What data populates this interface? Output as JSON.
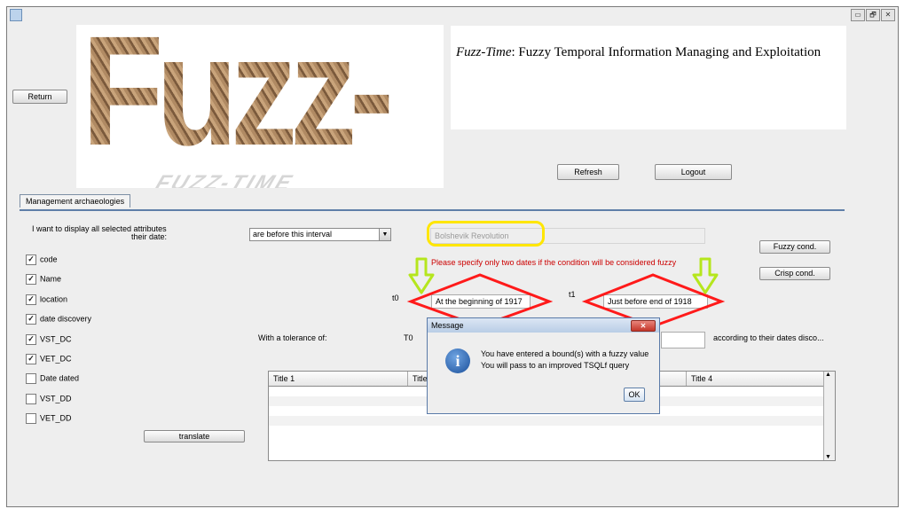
{
  "window": {
    "minimize_glyph": "▭",
    "maximize_glyph": "🗗",
    "close_glyph": "✕"
  },
  "toolbar": {
    "return_label": "Return",
    "refresh_label": "Refresh",
    "logout_label": "Logout"
  },
  "logo": {
    "text": "Fuzz-Time",
    "shadow_text": "FUZZ-TIME"
  },
  "description": {
    "italic_part": "Fuzz-Time",
    "rest": ": Fuzzy Temporal Information Managing and Exploitation"
  },
  "tabs": [
    {
      "label": "Management archaeologies"
    }
  ],
  "form": {
    "intro_line1": "I want to display all selected attributes",
    "intro_line2": "their date:",
    "condition_value": "are before this interval",
    "event_value": "Bolshevik Revolution",
    "fuzzy_cond_label": "Fuzzy cond.",
    "crisp_cond_label": "Crisp cond.",
    "warning": "Please specify only two dates if the condition will be considered fuzzy",
    "t0_label": "t0",
    "t1_label": "t1",
    "t0_value": "At the beginning of 1917",
    "t1_value": "Just before end of 1918",
    "tolerance_label": "With a tolerance of:",
    "T0_label": "T0",
    "according_label": "according to their dates disco...",
    "translate_label": "translate"
  },
  "attributes": [
    {
      "label": "code",
      "checked": true
    },
    {
      "label": "Name",
      "checked": true
    },
    {
      "label": "location",
      "checked": true
    },
    {
      "label": "date discovery",
      "checked": true
    },
    {
      "label": "VST_DC",
      "checked": true
    },
    {
      "label": "VET_DC",
      "checked": true
    },
    {
      "label": "Date dated",
      "checked": false
    },
    {
      "label": "VST_DD",
      "checked": false
    },
    {
      "label": "VET_DD",
      "checked": false
    }
  ],
  "table": {
    "columns": [
      "Title 1",
      "Title",
      "",
      "Title 4"
    ]
  },
  "dialog": {
    "title": "Message",
    "line1": "You have entered a bound(s) with a fuzzy value",
    "line2": "You will pass to an improved TSQLf query",
    "ok_label": "OK",
    "close_glyph": "✕",
    "icon_glyph": "i"
  },
  "colors": {
    "warning": "#cc0000",
    "highlight_yellow": "#ffe600",
    "annotation_red": "#ff1a1a",
    "arrow_green": "#b5e61d",
    "tab_line": "#5f7fa8"
  }
}
